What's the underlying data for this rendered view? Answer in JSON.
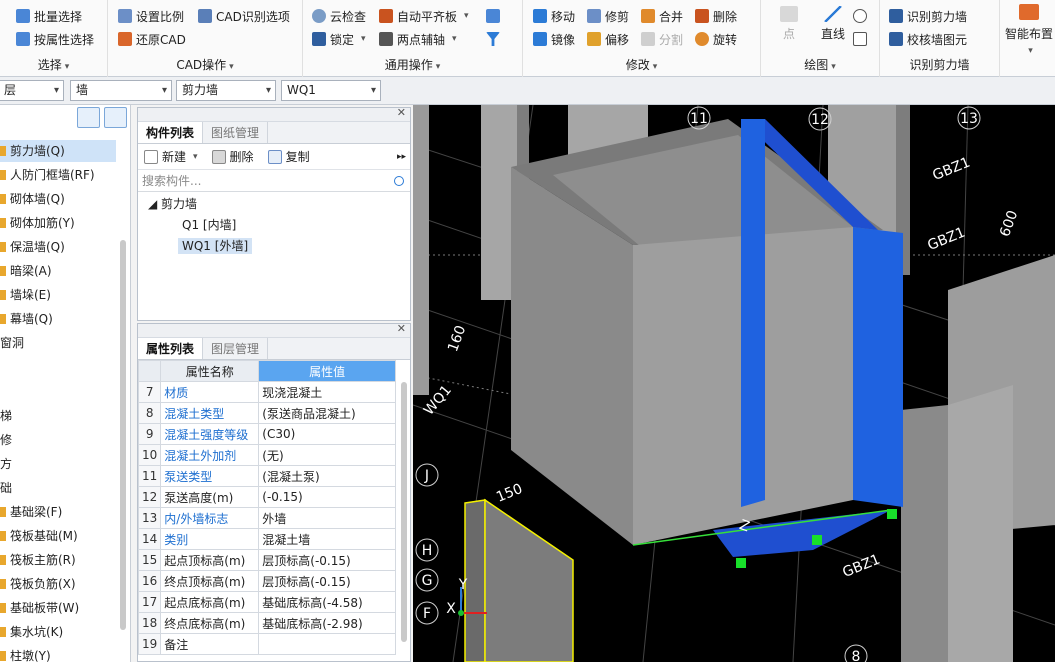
{
  "ribbon": {
    "select_group": {
      "title": "选择",
      "batch_select": "批量选择",
      "attr_select": "按属性选择"
    },
    "cad_group": {
      "title": "CAD操作",
      "set_scale": "设置比例",
      "cad_recog_options": "CAD识别选项",
      "restore_cad": "还原CAD"
    },
    "common_group": {
      "title": "通用操作",
      "cloud_check": "云检查",
      "auto_level": "自动平齐板",
      "lock": "锁定",
      "two_point_axis": "两点辅轴"
    },
    "modify_group": {
      "title": "修改",
      "move": "移动",
      "trim": "修剪",
      "merge": "合并",
      "delete": "删除",
      "mirror": "镜像",
      "offset": "偏移",
      "split": "分割",
      "rotate": "旋转"
    },
    "draw_group": {
      "title": "绘图",
      "point": "点",
      "line": "直线"
    },
    "recog_group": {
      "title": "识别剪力墙",
      "recog_wall": "识别剪力墙",
      "check_wall_elem": "校核墙图元"
    },
    "smart_layout": "智能布置"
  },
  "dropdowns": {
    "floor": "层",
    "category": "墙",
    "type": "剪力墙",
    "name": "WQ1"
  },
  "left_tree": {
    "items": [
      "剪力墙(Q)",
      "人防门框墙(RF)",
      "砌体墙(Q)",
      "砌体加筋(Y)",
      "保温墙(Q)",
      "暗梁(A)",
      "墙垛(E)",
      "幕墙(Q)",
      "窗洞",
      "梯",
      "修",
      "方",
      "础",
      "基础梁(F)",
      "筏板基础(M)",
      "筏板主筋(R)",
      "筏板负筋(X)",
      "基础板带(W)",
      "集水坑(K)",
      "柱墩(Y)"
    ]
  },
  "component_panel": {
    "tab_active": "构件列表",
    "tab_inactive": "图纸管理",
    "new": "新建",
    "delete": "删除",
    "copy": "复制",
    "search_placeholder": "搜索构件...",
    "root": "剪力墙",
    "child1": "Q1 [内墙]",
    "child2": "WQ1 [外墙]"
  },
  "property_panel": {
    "tab_active": "属性列表",
    "tab_inactive": "图层管理",
    "col_name": "属性名称",
    "col_value": "属性值",
    "rows": [
      {
        "num": "7",
        "name": "材质",
        "value": "现浇混凝土"
      },
      {
        "num": "8",
        "name": "混凝土类型",
        "value": "(泵送商品混凝土)"
      },
      {
        "num": "9",
        "name": "混凝土强度等级",
        "value": "(C30)"
      },
      {
        "num": "10",
        "name": "混凝土外加剂",
        "value": "(无)"
      },
      {
        "num": "11",
        "name": "泵送类型",
        "value": "(混凝土泵)"
      },
      {
        "num": "12",
        "name": "泵送高度(m)",
        "value": "(-0.15)"
      },
      {
        "num": "13",
        "name": "内/外墙标志",
        "value": "外墙"
      },
      {
        "num": "14",
        "name": "类别",
        "value": "混凝土墙"
      },
      {
        "num": "15",
        "name": "起点顶标高(m)",
        "value": "层顶标高(-0.15)"
      },
      {
        "num": "16",
        "name": "终点顶标高(m)",
        "value": "层顶标高(-0.15)"
      },
      {
        "num": "17",
        "name": "起点底标高(m)",
        "value": "基础底标高(-4.58)"
      },
      {
        "num": "18",
        "name": "终点底标高(m)",
        "value": "基础底标高(-2.98)"
      },
      {
        "num": "19",
        "name": "备注",
        "value": ""
      }
    ]
  },
  "viewport": {
    "axis_top": [
      "11",
      "12",
      "13"
    ],
    "axis_left": [
      "J",
      "H",
      "G",
      "F"
    ],
    "axis_bottom": [
      "8"
    ],
    "labels": [
      "GBZ1",
      "GBZ1",
      "GBZ1",
      "150",
      "160",
      "600",
      "WQ1",
      "Z",
      "Y",
      "X"
    ]
  }
}
